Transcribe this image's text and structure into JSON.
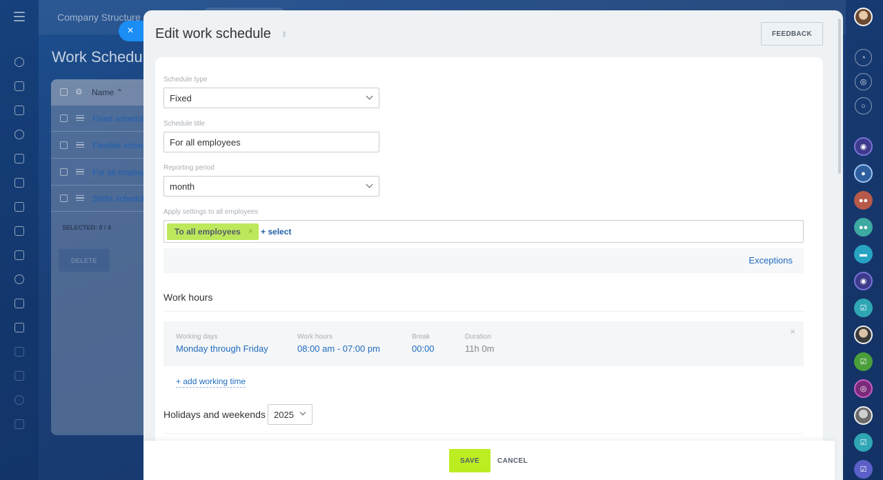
{
  "background": {
    "company_label": "Company Structure",
    "page_title": "Work Schedule",
    "table_header": "Name",
    "rows": [
      "Fixed schedule",
      "Flexible schedule",
      "For all employees",
      "Shifts schedule"
    ],
    "selected_label": "SELECTED:",
    "selected_count": "0 / 4",
    "delete_label": "DELETE"
  },
  "slider": {
    "title": "Edit work schedule",
    "feedback_label": "FEEDBACK",
    "close_glyph": "×"
  },
  "form": {
    "schedule_type": {
      "label": "Schedule type",
      "value": "Fixed"
    },
    "schedule_title": {
      "label": "Schedule title",
      "value": "For all employees"
    },
    "reporting_period": {
      "label": "Reporting period",
      "value": "month"
    },
    "apply": {
      "label": "Apply settings to all employees",
      "tag": "To all employees",
      "select_link": "+ select"
    },
    "exceptions_label": "Exceptions"
  },
  "work_hours": {
    "section_title": "Work hours",
    "working_days_label": "Working days",
    "working_days_value": "Monday through Friday",
    "hours_label": "Work hours",
    "hours_value": "08:00 am - 07:00 pm",
    "break_label": "Break",
    "break_value": "00:00",
    "duration_label": "Duration",
    "duration_value": "11h 0m",
    "add_link": "+ add working time"
  },
  "holidays": {
    "section_title": "Holidays and weekends",
    "year": "2025"
  },
  "footer": {
    "save_label": "SAVE",
    "cancel_label": "CANCEL"
  },
  "colors": {
    "accent_blue": "#1f6bbf",
    "save_green": "#bbed21",
    "tag_green": "#bde85b",
    "close_blue": "#1a8ef5"
  },
  "icons": {
    "left_rail": [
      "menu-icon",
      "activity-stream-icon",
      "chat-icon",
      "feed-icon",
      "tasks-icon",
      "calendar-icon",
      "docs-icon",
      "presentation-icon",
      "crm-icon",
      "mail-icon",
      "contacts-icon",
      "checklist-icon",
      "filter-icon",
      "marketing-icon",
      "store-icon",
      "settings-icon",
      "cart-icon"
    ],
    "right_rail": [
      "user-avatar",
      "notifications-icon",
      "fingerprint-icon",
      "search-chat-icon",
      "open-channel-icon",
      "user-chat-avatar",
      "group-chat-icon",
      "group-chat-icon",
      "chat-bubble-icon",
      "open-channel-icon",
      "task-chat-icon",
      "user-chat-avatar",
      "task-chat-icon",
      "channel-icon",
      "user-chat-avatar",
      "task-chat-icon",
      "task-chat-icon"
    ]
  }
}
